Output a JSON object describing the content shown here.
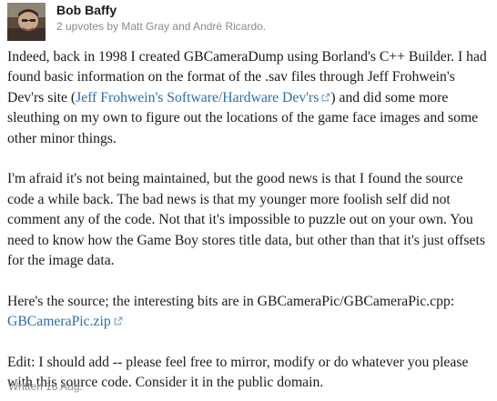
{
  "author": {
    "name": "Bob Baffy",
    "upvotes": "2 upvotes by Matt Gray and André Ricardo."
  },
  "post": {
    "p1_before": "Indeed, back in 1998 I created GBCameraDump using Borland's C++ Builder. I had found basic information on the format of the .sav files through Jeff Frohwein's Dev'rs site (",
    "p1_link": "Jeff Frohwein's Software/Hardware Dev'rs",
    "p1_after": ") and did some more sleuthing on my own to figure out the locations of the game face images and some other minor things.",
    "p2": "I'm afraid it's not being maintained, but the good news is that I found the source code a while back. The bad news is that my younger more foolish self did not comment any of the code. Not that it's impossible to puzzle out on your own. You need to know how the Game Boy stores title data, but other than that it's just offsets for the image data.",
    "p3_text": "Here's the source; the interesting bits are in GBCameraPic/GBCameraPic.cpp: ",
    "p3_link": "GBCameraPic.zip",
    "p4": "Edit: I should add -- please feel free to mirror, modify or do whatever you please with this source code. Consider it in the public domain."
  },
  "footer": {
    "written": "Written 18 Aug."
  },
  "colors": {
    "link": "#2b6dad",
    "meta": "#8a8a8a",
    "text": "#1a1a1a"
  },
  "icons": {
    "external_link": "external-link-icon"
  }
}
